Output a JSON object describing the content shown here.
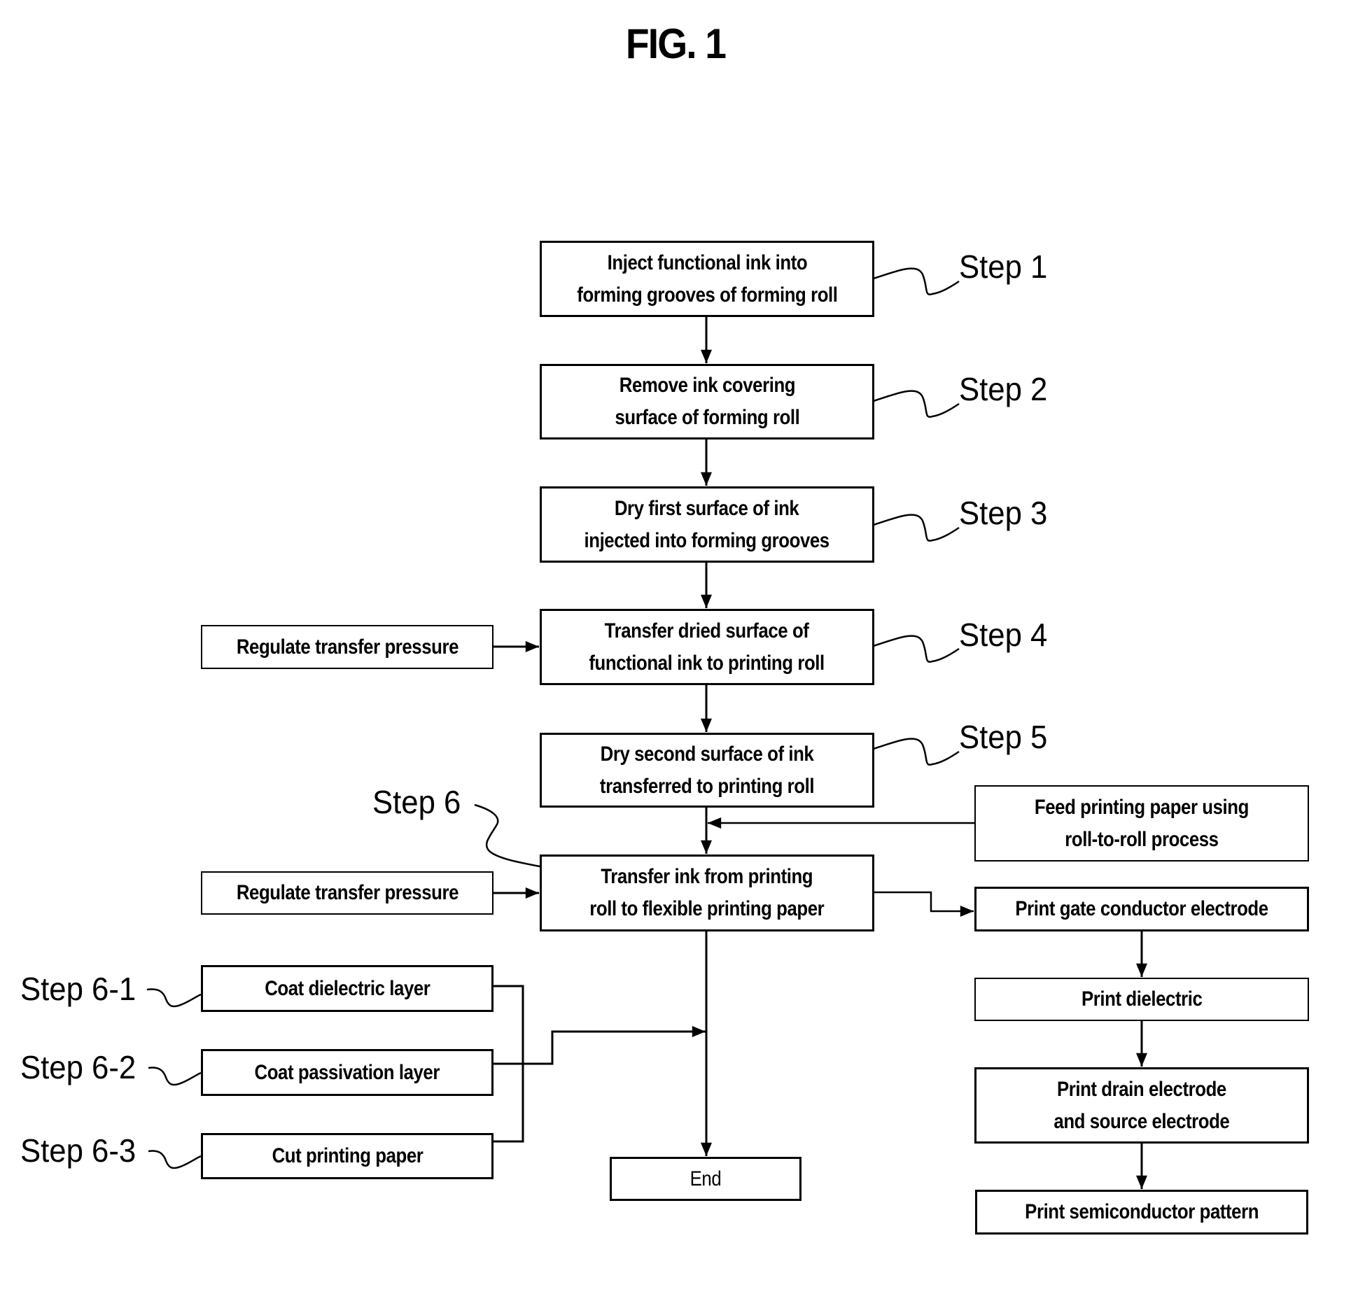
{
  "figure": {
    "title": "FIG. 1"
  },
  "main_flow": [
    {
      "id": "step1",
      "text": "Inject functional ink into\nforming grooves of forming roll",
      "label": "Step 1"
    },
    {
      "id": "step2",
      "text": "Remove ink covering\nsurface of forming roll",
      "label": "Step 2"
    },
    {
      "id": "step3",
      "text": "Dry first surface of ink\ninjected into forming grooves",
      "label": "Step 3"
    },
    {
      "id": "step4",
      "text": "Transfer dried surface of\nfunctional ink to printing roll",
      "label": "Step 4"
    },
    {
      "id": "step5",
      "text": "Dry second surface of ink\ntransferred to printing roll",
      "label": "Step 5"
    },
    {
      "id": "step6",
      "text": "Transfer ink from printing\nroll to flexible printing paper",
      "label": "Step 6"
    }
  ],
  "side_inputs": {
    "regulate_1": "Regulate transfer pressure",
    "regulate_2": "Regulate transfer pressure",
    "feed_paper": "Feed printing paper using\nroll-to-roll process"
  },
  "post_steps": [
    {
      "id": "step6-1",
      "text": "Coat dielectric layer",
      "label": "Step 6-1"
    },
    {
      "id": "step6-2",
      "text": "Coat passivation layer",
      "label": "Step 6-2"
    },
    {
      "id": "step6-3",
      "text": "Cut printing paper",
      "label": "Step 6-3"
    }
  ],
  "transistor_flow": [
    {
      "id": "gate",
      "text": "Print gate conductor electrode"
    },
    {
      "id": "dielectric",
      "text": "Print dielectric"
    },
    {
      "id": "drain-source",
      "text": "Print drain electrode\nand source electrode"
    },
    {
      "id": "semiconductor",
      "text": "Print semiconductor pattern"
    }
  ],
  "end": {
    "text": "End"
  },
  "colors": {
    "ink": "#000000",
    "background": "#ffffff"
  }
}
